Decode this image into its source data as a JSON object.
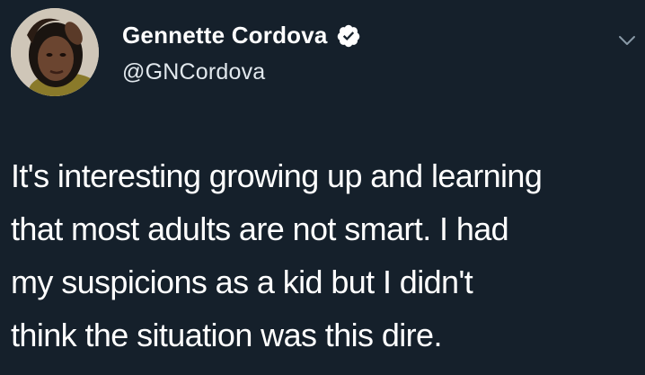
{
  "author": {
    "display_name": "Gennette Cordova",
    "handle": "@GNCordova",
    "verified": true
  },
  "icons": {
    "verified": "verified-badge-icon",
    "menu": "chevron-down-icon"
  },
  "tweet": {
    "lines": [
      "It's interesting growing up and learning",
      "that most adults are not smart. I had",
      "my suspicions as a kid but I didn't",
      "think the situation was this dire."
    ]
  },
  "colors": {
    "background": "#15202b",
    "text": "#ffffff",
    "handle": "#e1e8ed",
    "chevron": "#8899a6"
  }
}
